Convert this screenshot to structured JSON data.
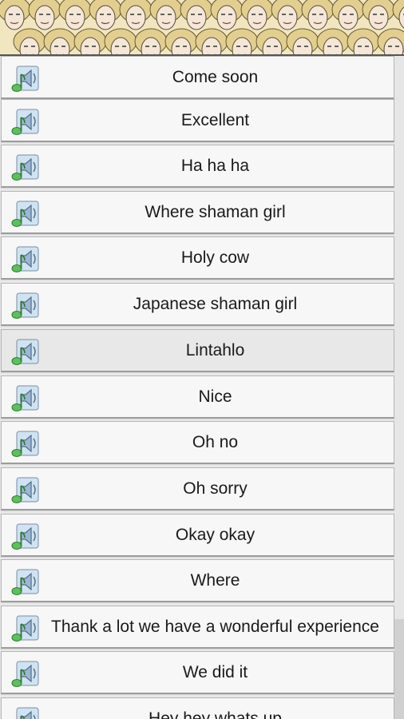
{
  "header": {
    "banner_image": "crowd-of-faces-banner"
  },
  "list": {
    "item_icon": "speaker-music-note-icon",
    "pressed_index": 6,
    "items": [
      {
        "label": "Come soon"
      },
      {
        "label": "Excellent"
      },
      {
        "label": "Ha ha ha"
      },
      {
        "label": "Where shaman girl"
      },
      {
        "label": "Holy cow"
      },
      {
        "label": "Japanese shaman girl"
      },
      {
        "label": "Lintahlo"
      },
      {
        "label": "Nice"
      },
      {
        "label": "Oh no"
      },
      {
        "label": "Oh sorry"
      },
      {
        "label": "Okay okay"
      },
      {
        "label": "Where"
      },
      {
        "label": "Thank a lot we have a wonderful experience"
      },
      {
        "label": "We did it"
      },
      {
        "label": "Hey hey whats up"
      }
    ]
  }
}
